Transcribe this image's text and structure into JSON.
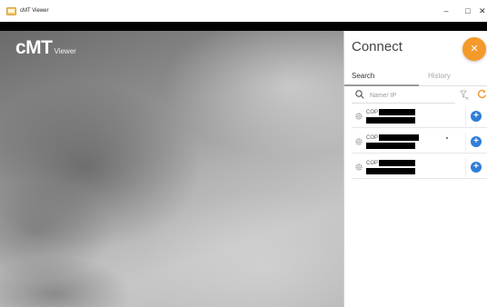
{
  "window": {
    "title": "cMT Viewer",
    "controls": {
      "minimize": "–",
      "maximize": "□",
      "close": "✕"
    }
  },
  "logo": {
    "main": "cMT",
    "sub": "Viewer"
  },
  "connect": {
    "title": "Connect",
    "close_label": "✕",
    "tabs": [
      {
        "label": "Search",
        "active": true
      },
      {
        "label": "History",
        "active": false
      }
    ],
    "search": {
      "placeholder": "Name/ IP",
      "value": ""
    },
    "devices": [
      {
        "name": "COP",
        "add_label": "+"
      },
      {
        "name": "COP",
        "add_label": "+"
      },
      {
        "name": "COP",
        "add_label": "+"
      }
    ]
  },
  "colors": {
    "accent": "#f39a2b",
    "add_button": "#2f7ed8",
    "refresh_icon": "#f39a2b"
  },
  "icons": [
    "app-icon",
    "search-icon",
    "filter-icon",
    "refresh-icon",
    "gear-icon",
    "plus-icon",
    "close-icon"
  ]
}
